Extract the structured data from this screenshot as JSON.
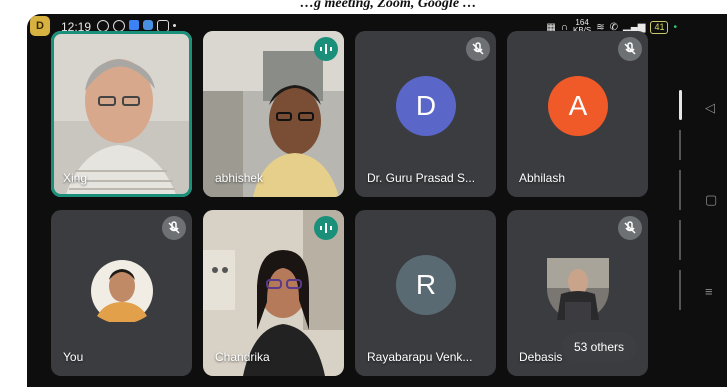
{
  "statusbar": {
    "app_badge": "D",
    "time": "12:19",
    "network_speed": "164",
    "network_unit": "KB/S",
    "battery": "41"
  },
  "caption_top": "…g meeting, Zoom, Google …",
  "participants": [
    {
      "name": "Xing",
      "type": "video",
      "active_speaker": true,
      "mic": "on"
    },
    {
      "name": "abhishek",
      "type": "video",
      "active_speaker": false,
      "mic": "speaking"
    },
    {
      "name": "Dr. Guru Prasad S...",
      "type": "avatar",
      "initial": "D",
      "color": "#5a67c8",
      "mic": "muted"
    },
    {
      "name": "Abhilash",
      "type": "avatar",
      "initial": "A",
      "color": "#f05a28",
      "mic": "muted"
    },
    {
      "name": "You",
      "type": "photo",
      "mic": "muted"
    },
    {
      "name": "Chandrika",
      "type": "video",
      "mic": "speaking"
    },
    {
      "name": "Rayabarapu Venk...",
      "type": "avatar",
      "initial": "R",
      "color": "#5a6a73",
      "mic": "none"
    },
    {
      "name": "Debasis",
      "type": "photo",
      "mic": "muted"
    }
  ],
  "overflow_label": "53 others",
  "colors": {
    "active_border": "#1a8f7a",
    "tile_bg": "#3a3c40",
    "speaking": "#1a8f7a"
  }
}
